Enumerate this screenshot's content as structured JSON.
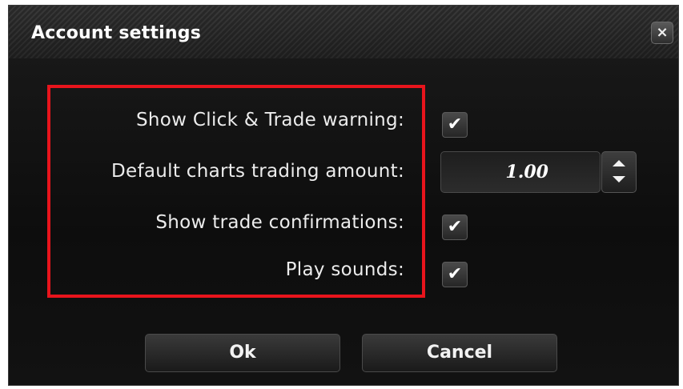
{
  "dialog": {
    "title": "Account settings",
    "close_glyph": "×",
    "close_icon": "close-icon"
  },
  "settings": {
    "click_trade_warning": {
      "label": "Show Click & Trade warning:",
      "checked": true
    },
    "default_amount": {
      "label": "Default charts trading amount:",
      "value": "1.00"
    },
    "trade_confirmations": {
      "label": "Show trade confirmations:",
      "checked": true
    },
    "play_sounds": {
      "label": "Play sounds:",
      "checked": true
    }
  },
  "check_glyph": "✔",
  "buttons": {
    "ok": "Ok",
    "cancel": "Cancel"
  },
  "colors": {
    "highlight": "#e8141c",
    "background": "#111111",
    "text": "#ececec"
  }
}
